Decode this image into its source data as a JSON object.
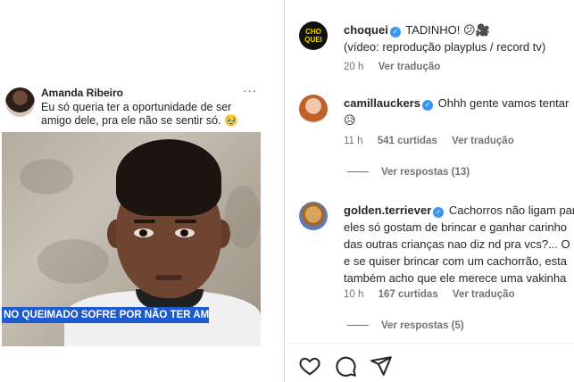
{
  "tweet": {
    "author": "Amanda Ribeiro",
    "more": "···",
    "text": "Eu só queria ter a oportunidade de ser amigo dele, pra ele não se sentir só. 🥹"
  },
  "media": {
    "banner": "NO QUEIMADO SOFRE POR NÃO TER AMIGOS"
  },
  "comments": [
    {
      "avatar_text": "CHO QUEI",
      "user": "choquei",
      "text": "TADINHO! 😕🎥",
      "text2": "(vídeo: reprodução playplus / record tv)",
      "time": "20 h",
      "likes": "",
      "translate": "Ver tradução"
    },
    {
      "user": "camillauckers",
      "text": "Ohhh gente vamos tentar",
      "text2": "😥",
      "time": "11 h",
      "likes": "541 curtidas",
      "translate": "Ver tradução",
      "replies": "Ver respostas (13)"
    },
    {
      "user": "golden.terriever",
      "text": "Cachorros não ligam para",
      "lines": [
        "eles só gostam de brincar e ganhar carinho",
        "das outras crianças nao diz nd pra vcs?... O",
        "e se quiser brincar com um cachorrão, esta",
        "também acho que ele merece uma vakinha"
      ],
      "time": "10 h",
      "likes": "167 curtidas",
      "translate": "Ver tradução",
      "replies": "Ver respostas (5)"
    }
  ],
  "actions": [
    "heart-icon",
    "comment-icon",
    "share-icon"
  ],
  "colors": {
    "verified": "#3897f0",
    "banner": "#1e5bd1",
    "meta": "#737373"
  }
}
